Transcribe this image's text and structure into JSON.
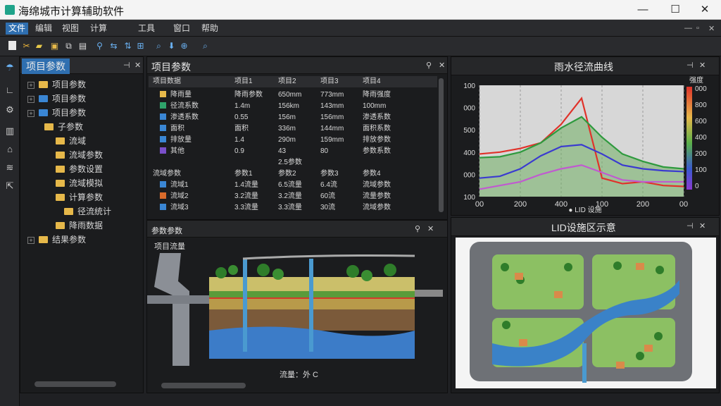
{
  "window": {
    "title": "海绵城市计算辅助软件",
    "min": "—",
    "max": "☐",
    "close": "✕"
  },
  "menu": {
    "items": [
      "文件",
      "编辑",
      "视图",
      "计算",
      "工具",
      "窗口",
      "帮助"
    ],
    "right": [
      "—",
      "▫",
      "✕"
    ]
  },
  "tree": {
    "title": "项目参数",
    "rows": [
      {
        "label": "项目参数",
        "level": 1,
        "icon": "folder-yellow"
      },
      {
        "label": "项目参数",
        "level": 1,
        "icon": "folder-blue"
      },
      {
        "label": "项目参数",
        "level": 1,
        "icon": "folder-blue"
      },
      {
        "label": "子参数",
        "level": 2,
        "icon": "folder-yellow"
      },
      {
        "label": "流域",
        "level": 3,
        "icon": "folder-yellow"
      },
      {
        "label": "流域参数",
        "level": 3,
        "icon": "folder-yellow"
      },
      {
        "label": "参数设置",
        "level": 3,
        "icon": "folder-yellow"
      },
      {
        "label": "流域模拟",
        "level": 3,
        "icon": "folder-yellow"
      },
      {
        "label": "计算参数",
        "level": 3,
        "icon": "folder-yellow"
      },
      {
        "label": "径流统计",
        "level": 4,
        "icon": "folder-yellow"
      },
      {
        "label": "降雨数据",
        "level": 3,
        "icon": "folder-yellow"
      },
      {
        "label": "结果参数",
        "level": 1,
        "icon": "folder-yellow"
      }
    ]
  },
  "grid": {
    "title": "项目参数",
    "headers": [
      "项目数据",
      "项目1",
      "项目2",
      "项目3",
      "项目4"
    ],
    "rows": [
      {
        "color": "#e6b84a",
        "cells": [
          "降雨量",
          "降雨参数",
          "650mm",
          "773mm",
          "降雨强度"
        ]
      },
      {
        "color": "#2fa36b",
        "cells": [
          "径流系数",
          "1.4m",
          "156km",
          "143mm",
          "100mm"
        ]
      },
      {
        "color": "#3a86d4",
        "cells": [
          "渗透系数",
          "0.55",
          "156m",
          "156mm",
          "渗透系数"
        ]
      },
      {
        "color": "#3a86d4",
        "cells": [
          "面积",
          "面积",
          "336m",
          "144mm",
          "面积系数"
        ]
      },
      {
        "color": "#3a86d4",
        "cells": [
          "排放量",
          "1.4",
          "290m",
          "159mm",
          "排放参数"
        ]
      },
      {
        "color": "#7a4fc9",
        "cells": [
          "其他",
          "0.9",
          "43",
          "80",
          "参数系数"
        ]
      }
    ],
    "extra_row": "2.5参数",
    "headers2": [
      "流域参数",
      "参数1",
      "参数2",
      "参数3",
      "参数4"
    ],
    "rows2": [
      {
        "color": "#3a86d4",
        "cells": [
          "流域1",
          "1.4流量",
          "6.5流量",
          "6.4流",
          "流域参数"
        ]
      },
      {
        "color": "#d96b2b",
        "cells": [
          "流域2",
          "3.2流量",
          "3.2流量",
          "60流",
          "流量参数"
        ]
      },
      {
        "color": "#3a86d4",
        "cells": [
          "流域3",
          "3.3流量",
          "3.3流量",
          "30流",
          "流域参数"
        ]
      }
    ]
  },
  "params": {
    "title": "参数参数",
    "subtitle": "项目流量",
    "footer": "流量：外 C"
  },
  "chart_panel": {
    "title": "雨水径流曲线",
    "legend_title": "强度",
    "legend_ticks": [
      "000",
      "800",
      "600",
      "400",
      "200",
      "100",
      "0"
    ],
    "footer": "● LID 设施"
  },
  "chart_data": {
    "type": "area",
    "title": "雨水径流曲线",
    "x": [
      0,
      100,
      200,
      300,
      400,
      500,
      600,
      700,
      800,
      900,
      1000
    ],
    "xticks": [
      0,
      200,
      400,
      600,
      800,
      1000
    ],
    "xlabels": [
      "00",
      "200",
      "400",
      "100",
      "200",
      "00"
    ],
    "ylabels": [
      "100",
      "000",
      "500",
      "400",
      "000",
      "100"
    ],
    "ylim": [
      0,
      600
    ],
    "series": [
      {
        "color": "#e0322a",
        "values": [
          230,
          240,
          260,
          290,
          390,
          530,
          100,
          70,
          80,
          60,
          55
        ]
      },
      {
        "color": "#2e9a3e",
        "values": [
          210,
          215,
          240,
          290,
          370,
          430,
          320,
          230,
          190,
          160,
          150
        ]
      },
      {
        "color": "#3a3ad0",
        "values": [
          100,
          110,
          150,
          220,
          270,
          280,
          230,
          170,
          150,
          140,
          135
        ]
      },
      {
        "color": "#c05ad0",
        "values": [
          40,
          60,
          80,
          120,
          150,
          170,
          130,
          90,
          80,
          80,
          80
        ]
      }
    ]
  },
  "map_panel": {
    "title": "LID设施区示意"
  },
  "colors": {
    "accent": "#2f6fb0",
    "water": "#3a82c8",
    "grass": "#7dbf5a"
  }
}
